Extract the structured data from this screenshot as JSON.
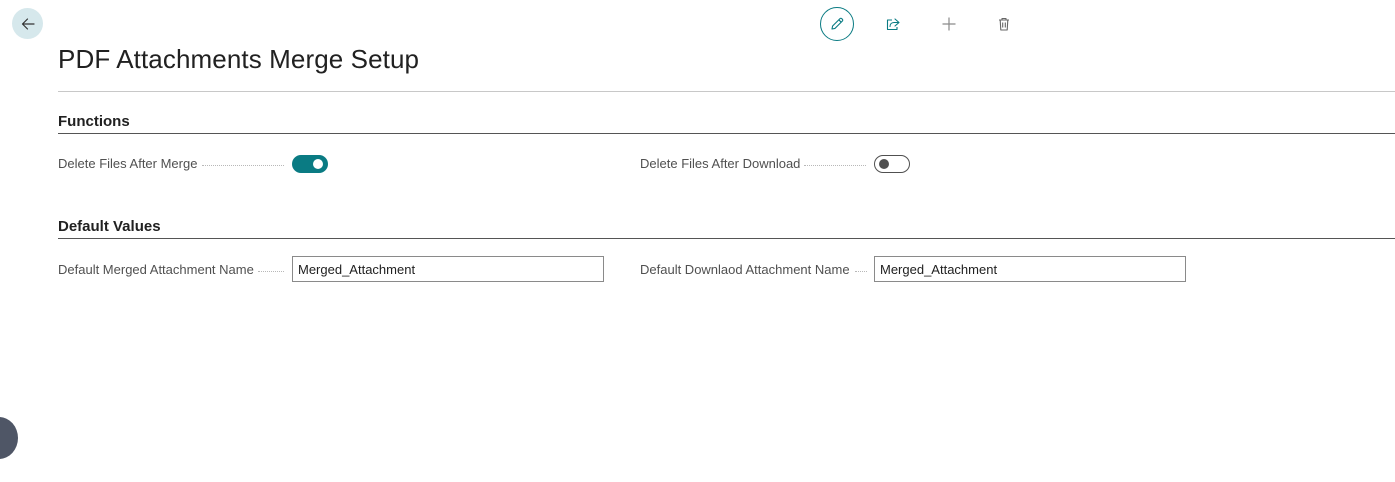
{
  "header": {
    "back_icon": "arrow-left-icon",
    "actions": [
      {
        "name": "edit",
        "icon": "pencil-icon"
      },
      {
        "name": "share",
        "icon": "share-icon"
      },
      {
        "name": "new",
        "icon": "plus-icon"
      },
      {
        "name": "delete",
        "icon": "trash-icon"
      }
    ]
  },
  "page": {
    "title": "PDF Attachments Merge Setup"
  },
  "sections": {
    "functions": {
      "title": "Functions",
      "delete_after_merge": {
        "label": "Delete Files After Merge",
        "value": true
      },
      "delete_after_download": {
        "label": "Delete Files After Download",
        "value": false
      }
    },
    "default_values": {
      "title": "Default Values",
      "merged_name": {
        "label": "Default Merged Attachment Name",
        "value": "Merged_Attachment"
      },
      "download_name": {
        "label": "Default Downlaod Attachment Name",
        "value": "Merged_Attachment"
      }
    }
  },
  "colors": {
    "accent": "#0a7b83",
    "back_button_bg": "#d6e8ec",
    "side_handle": "#4f5666"
  }
}
